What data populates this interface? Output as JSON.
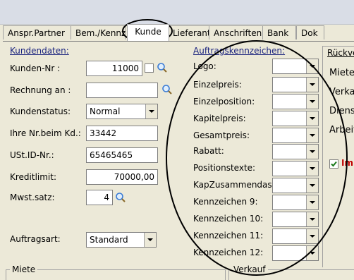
{
  "tabs": [
    {
      "label": "Anspr.Partner"
    },
    {
      "label": "Bem./Kennz"
    },
    {
      "label": "Kunde"
    },
    {
      "label": "Lieferant"
    },
    {
      "label": "Anschriften"
    },
    {
      "label": "Bank"
    },
    {
      "label": "Dok"
    }
  ],
  "kundendaten": {
    "title": "Kundendaten:",
    "kunden_nr_label": "Kunden-Nr :",
    "kunden_nr": "11000",
    "rechnung_an_label": "Rechnung an :",
    "rechnung_an": "",
    "kundenstatus_label": "Kundenstatus:",
    "kundenstatus": "Normal",
    "ihre_nr_label": "Ihre Nr.beim Kd.:",
    "ihre_nr": "33442",
    "ustid_label": "USt.ID-Nr.:",
    "ustid": "65465465",
    "kreditlimit_label": "Kreditlimit:",
    "kreditlimit": "70000,00",
    "mwst_label": "Mwst.satz:",
    "mwst": "4",
    "auftragsart_label": "Auftragsart:",
    "auftragsart": "Standard"
  },
  "auftragskennzeichen": {
    "title": "Auftragskennzeichen:",
    "items": [
      {
        "label": "Logo:"
      },
      {
        "label": "Einzelpreis:"
      },
      {
        "label": "Einzelposition:"
      },
      {
        "label": "Kapitelpreis:"
      },
      {
        "label": "Gesamtpreis:"
      },
      {
        "label": "Rabatt:"
      },
      {
        "label": "Positionstexte:"
      },
      {
        "label": "KapZusammendass"
      },
      {
        "label": "Kennzeichen 9:"
      },
      {
        "label": "Kennzeichen 10:"
      },
      {
        "label": "Kennzeichen 11:"
      },
      {
        "label": "Kennzeichen 12:"
      }
    ]
  },
  "right": {
    "title": "Rückve",
    "items": [
      "Miete",
      "Verka",
      "Diens",
      "Arbeit"
    ],
    "checked_label": "Im"
  },
  "bottom": {
    "miete": "Miete",
    "verkauf": "Verkauf"
  }
}
